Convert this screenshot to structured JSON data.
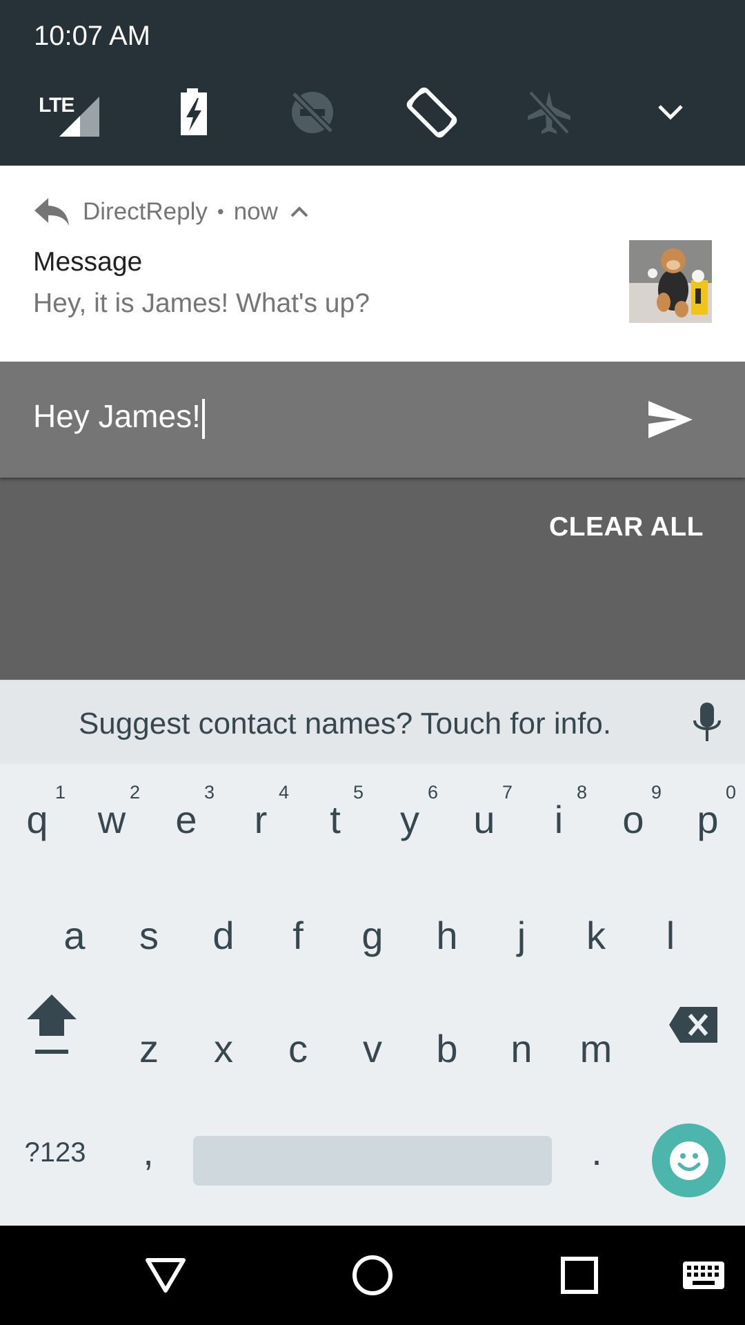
{
  "status": {
    "time": "10:07 AM"
  },
  "quick_settings": {
    "tiles": [
      {
        "icon": "lte-signal-icon",
        "label": "LTE"
      },
      {
        "icon": "battery-saver-icon"
      },
      {
        "icon": "do-not-disturb-off-icon"
      },
      {
        "icon": "auto-rotate-icon"
      },
      {
        "icon": "airplane-mode-off-icon"
      },
      {
        "icon": "expand-chevron-icon"
      }
    ]
  },
  "notification": {
    "app_name": "DirectReply",
    "separator": "•",
    "time": "now",
    "title": "Message",
    "text": "Hey, it is James! What's up?"
  },
  "reply": {
    "value": "Hey James!"
  },
  "clear_all_label": "CLEAR ALL",
  "keyboard": {
    "suggestion": "Suggest contact names? Touch for info.",
    "row1": [
      "q",
      "w",
      "e",
      "r",
      "t",
      "y",
      "u",
      "i",
      "o",
      "p"
    ],
    "row1_hints": [
      "1",
      "2",
      "3",
      "4",
      "5",
      "6",
      "7",
      "8",
      "9",
      "0"
    ],
    "row2": [
      "a",
      "s",
      "d",
      "f",
      "g",
      "h",
      "j",
      "k",
      "l"
    ],
    "row3": [
      "z",
      "x",
      "c",
      "v",
      "b",
      "n",
      "m"
    ],
    "symbols_label": "?123",
    "comma": ",",
    "period": "."
  },
  "colors": {
    "accent": "#4db6ac",
    "header": "#263238",
    "reply_bg": "#757575"
  }
}
